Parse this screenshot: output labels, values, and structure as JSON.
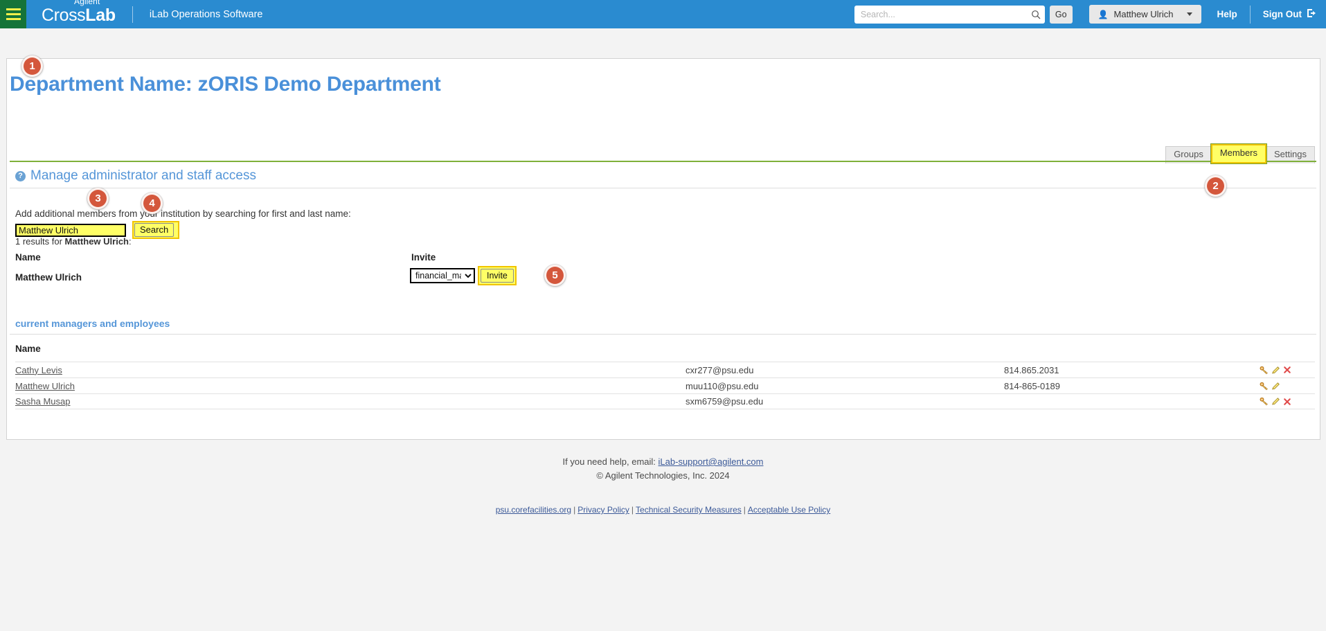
{
  "topbar": {
    "menu_icon": "hamburger-icon",
    "brand": {
      "agilent": "Agilent",
      "cross": "Cross",
      "lab": "Lab",
      "subtitle": "iLab Operations Software"
    },
    "search": {
      "placeholder": "Search...",
      "value": "",
      "icon": "search-icon",
      "go_label": "Go"
    },
    "user_menu": {
      "icon": "person-icon",
      "label": "Matthew Ulrich"
    },
    "help_label": "Help",
    "signout_label": "Sign Out",
    "signout_icon": "sign-out-icon"
  },
  "page": {
    "title": "Department Name: zORIS Demo Department"
  },
  "tabs": [
    {
      "label": "Groups",
      "highlighted": false
    },
    {
      "label": "Members",
      "highlighted": true
    },
    {
      "label": "Settings",
      "highlighted": false
    }
  ],
  "section": {
    "help_icon": "question-mark-icon",
    "title": "Manage administrator and staff access",
    "lead_text": "Add additional members from your institution by searching for first and last name:",
    "search_value": "Matthew Ulrich",
    "search_button_label": "Search",
    "results_prefix": "1 results for ",
    "results_query": "Matthew Ulrich",
    "results_suffix": ":"
  },
  "results_table": {
    "headers": {
      "name": "Name",
      "invite": "Invite"
    },
    "row": {
      "name": "Matthew Ulrich",
      "role_selected": "financial_manager",
      "role_options": [
        "financial_manager"
      ],
      "invite_button_label": "Invite"
    }
  },
  "current_members": {
    "title": "current managers and employees",
    "header_name": "Name",
    "rows": [
      {
        "name": "Cathy Levis",
        "email": "cxr277@psu.edu",
        "phone": "814.865.2031",
        "actions": [
          "user-key-icon",
          "edit-pencil-icon",
          "delete-x-icon"
        ]
      },
      {
        "name": "Matthew Ulrich",
        "email": "muu110@psu.edu",
        "phone": "814-865-0189",
        "actions": [
          "user-key-icon",
          "edit-pencil-icon"
        ]
      },
      {
        "name": "Sasha Musap",
        "email": "sxm6759@psu.edu",
        "phone": "",
        "actions": [
          "user-key-icon",
          "edit-pencil-icon",
          "delete-x-icon"
        ]
      }
    ]
  },
  "footer": {
    "help_prefix": "If you need help, email: ",
    "help_email": "iLab-support@agilent.com",
    "copyright": "© Agilent Technologies, Inc. 2024",
    "links": [
      "psu.corefacilities.org",
      "Privacy Policy",
      "Technical Security Measures",
      "Acceptable Use Policy"
    ],
    "separator": "|"
  },
  "step_badges": [
    {
      "number": "1"
    },
    {
      "number": "2"
    },
    {
      "number": "3"
    },
    {
      "number": "4"
    },
    {
      "number": "5"
    }
  ],
  "colors": {
    "brand_blue": "#2a8bd0",
    "menu_green": "#157339",
    "title_blue": "#4a90d9",
    "highlight_yellow": "#ffff66",
    "badge_orange": "#d4573c",
    "rule_green": "#7fb03a"
  }
}
